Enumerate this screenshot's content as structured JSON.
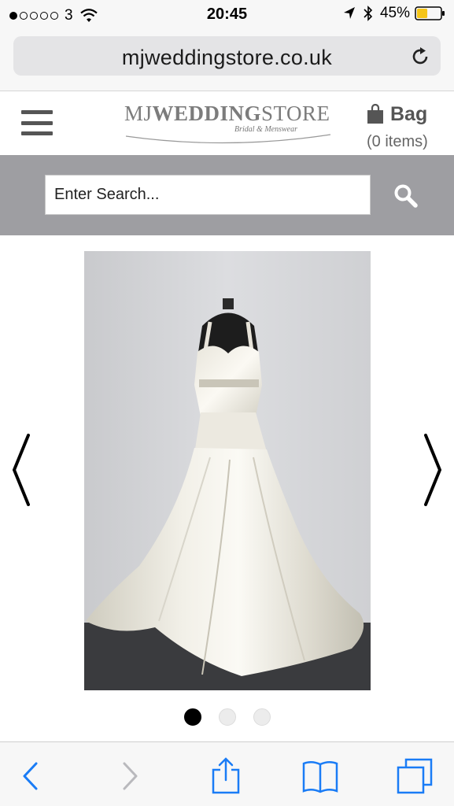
{
  "status_bar": {
    "carrier": "3",
    "time": "20:45",
    "battery": "45%",
    "battery_level": 0.45,
    "battery_color": "#f5c518",
    "signal_bars_filled": 1,
    "signal_bars_total": 5,
    "icons": [
      "wifi-icon",
      "location-icon",
      "bluetooth-icon",
      "battery-icon"
    ]
  },
  "browser": {
    "url": "mjweddingstore.co.uk",
    "reload_icon": "reload-icon"
  },
  "header": {
    "menu_icon": "hamburger-icon",
    "logo": {
      "main": "MJWEDDINGSTORE",
      "tagline": "Bridal & Menswear"
    },
    "bag": {
      "label": "Bag",
      "count": "(0 items)",
      "icon": "shopping-bag-icon"
    }
  },
  "search": {
    "placeholder": "Enter Search...",
    "icon": "search-icon",
    "band_color": "#9e9ea2"
  },
  "gallery": {
    "image_subject": "ivory satin wedding dress on mannequin",
    "prev_icon": "chevron-left-icon",
    "next_icon": "chevron-right-icon",
    "current_slide": 1,
    "total_slides": 3
  },
  "toolbar": {
    "buttons": [
      "back-icon",
      "forward-icon",
      "share-icon",
      "bookmarks-icon",
      "tabs-icon"
    ],
    "accent": "#1a7cf6",
    "disabled_color": "#b9b9bd"
  }
}
